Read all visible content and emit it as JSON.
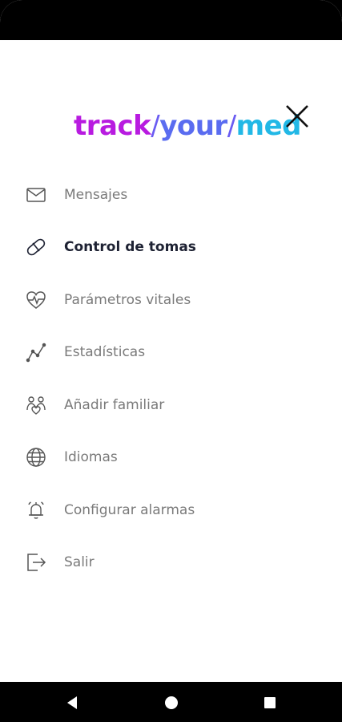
{
  "app": {
    "logo": {
      "part1": "track",
      "part2": "your",
      "part3": "med"
    }
  },
  "colors": {
    "logo_purple": "#b81be0",
    "logo_blue": "#5a6cf0",
    "logo_cyan": "#22b8e6",
    "menu_text": "#7a7a7a",
    "menu_active": "#1e2233"
  },
  "menu": {
    "items": [
      {
        "label": "Mensajes",
        "icon": "envelope-icon",
        "active": false
      },
      {
        "label": "Control de tomas",
        "icon": "pill-icon",
        "active": true
      },
      {
        "label": "Parámetros vitales",
        "icon": "heart-pulse-icon",
        "active": false
      },
      {
        "label": "Estadísticas",
        "icon": "line-chart-icon",
        "active": false
      },
      {
        "label": "Añadir familiar",
        "icon": "family-icon",
        "active": false
      },
      {
        "label": "Idiomas",
        "icon": "globe-icon",
        "active": false
      },
      {
        "label": "Configurar alarmas",
        "icon": "bell-icon",
        "active": false
      },
      {
        "label": "Salir",
        "icon": "logout-icon",
        "active": false
      }
    ]
  },
  "nav": {
    "back": "back-icon",
    "home": "home-icon",
    "recents": "recents-icon"
  }
}
